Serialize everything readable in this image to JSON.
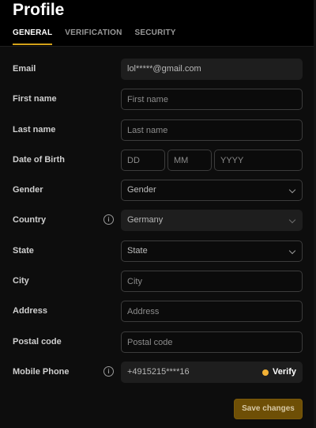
{
  "title": "Profile",
  "tabs": [
    {
      "label": "GENERAL",
      "active": true
    },
    {
      "label": "VERIFICATION",
      "active": false
    },
    {
      "label": "SECURITY",
      "active": false
    }
  ],
  "form": {
    "email": {
      "label": "Email",
      "value": "lol*****@gmail.com"
    },
    "first_name": {
      "label": "First name",
      "placeholder": "First name"
    },
    "last_name": {
      "label": "Last name",
      "placeholder": "Last name"
    },
    "dob": {
      "label": "Date of Birth",
      "day_placeholder": "DD",
      "month_placeholder": "MM",
      "year_placeholder": "YYYY"
    },
    "gender": {
      "label": "Gender",
      "value": "Gender"
    },
    "country": {
      "label": "Country",
      "value": "Germany",
      "info_icon": "info-icon"
    },
    "state": {
      "label": "State",
      "value": "State"
    },
    "city": {
      "label": "City",
      "placeholder": "City"
    },
    "address": {
      "label": "Address",
      "placeholder": "Address"
    },
    "postal_code": {
      "label": "Postal code",
      "placeholder": "Postal code"
    },
    "mobile_phone": {
      "label": "Mobile Phone",
      "value": "+4915215****16",
      "verify_label": "Verify",
      "info_icon": "info-icon"
    }
  },
  "save_label": "Save changes",
  "colors": {
    "accent": "#d4a21a",
    "verify_dot": "#f2b135",
    "save_bg": "#6e4f06"
  }
}
